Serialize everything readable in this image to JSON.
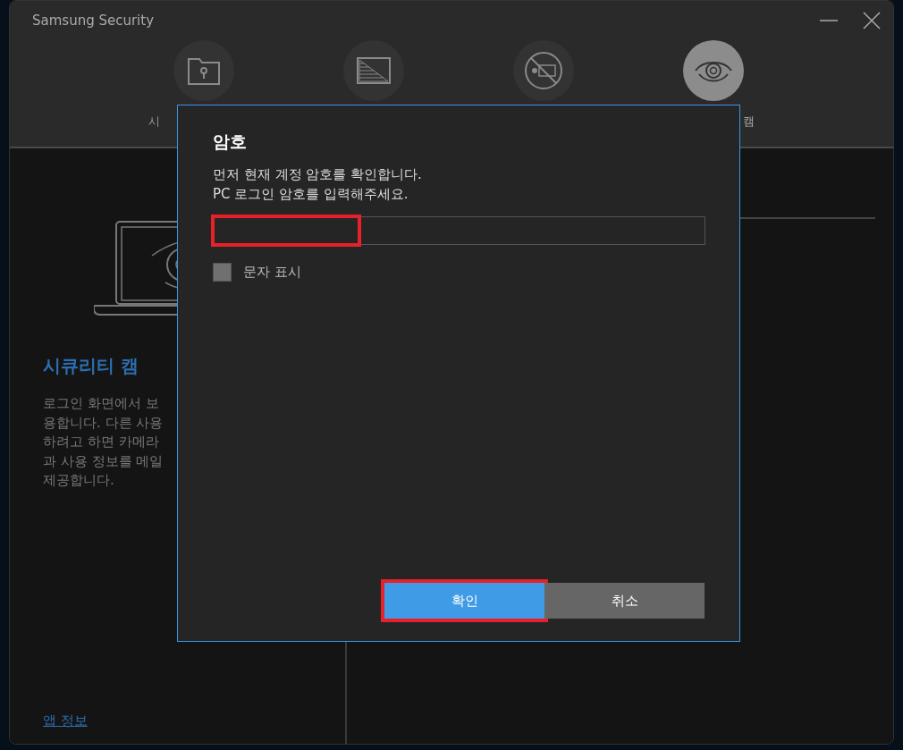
{
  "window": {
    "title": "Samsung Security"
  },
  "nav": [
    {
      "label": "시",
      "selected": false
    },
    {
      "selected": false
    },
    {
      "selected": false
    },
    {
      "label": "캠",
      "selected": true
    }
  ],
  "left_panel": {
    "heading": "시큐리티 캠",
    "description_lines": [
      "로그인 화면에서 보",
      "용합니다. 다른 사용",
      "하려고 하면 카메라",
      "과 사용 정보를 메일",
      "제공합니다."
    ],
    "link": "앱 정보"
  },
  "dialog": {
    "title": "암호",
    "message_lines": [
      "먼저 현재 계정 암호를 확인합니다.",
      "PC 로그인 암호를 입력해주세요."
    ],
    "password_field": {
      "highlighted": true
    },
    "show_characters": {
      "label": "문자 표시",
      "checked": false
    },
    "buttons": [
      {
        "label": "확인",
        "kind": "primary",
        "highlighted": true
      },
      {
        "label": "취소",
        "kind": "secondary",
        "highlighted": false
      }
    ]
  }
}
